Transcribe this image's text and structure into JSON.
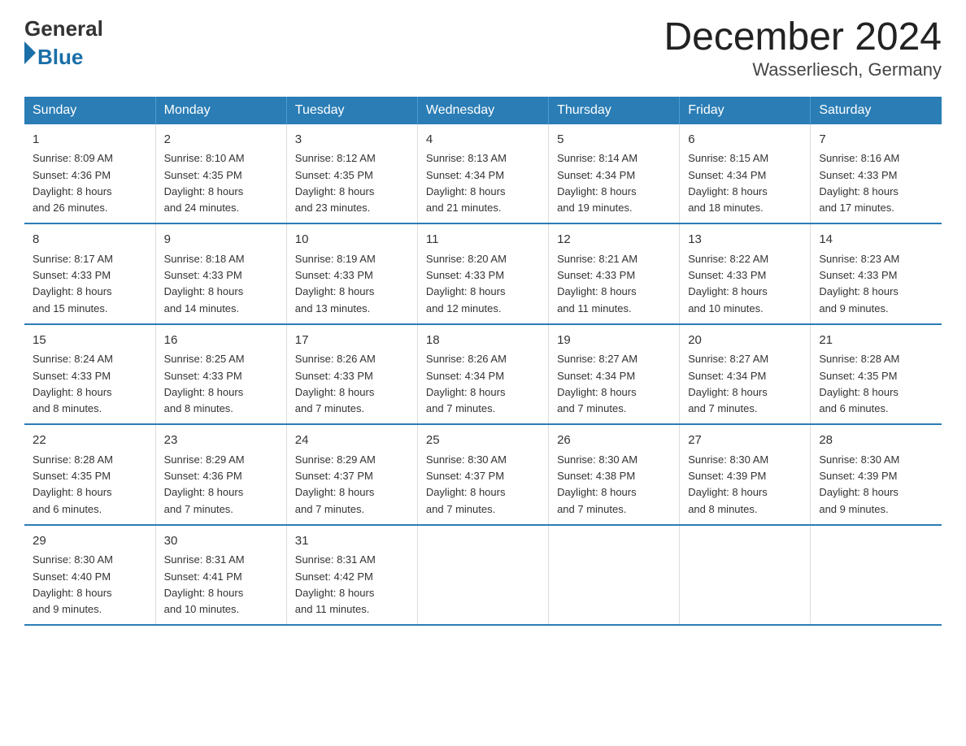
{
  "header": {
    "logo_general": "General",
    "logo_blue": "Blue",
    "title": "December 2024",
    "subtitle": "Wasserliesch, Germany"
  },
  "days_of_week": [
    "Sunday",
    "Monday",
    "Tuesday",
    "Wednesday",
    "Thursday",
    "Friday",
    "Saturday"
  ],
  "weeks": [
    [
      {
        "day": "1",
        "sunrise": "8:09 AM",
        "sunset": "4:36 PM",
        "daylight": "8 hours and 26 minutes."
      },
      {
        "day": "2",
        "sunrise": "8:10 AM",
        "sunset": "4:35 PM",
        "daylight": "8 hours and 24 minutes."
      },
      {
        "day": "3",
        "sunrise": "8:12 AM",
        "sunset": "4:35 PM",
        "daylight": "8 hours and 23 minutes."
      },
      {
        "day": "4",
        "sunrise": "8:13 AM",
        "sunset": "4:34 PM",
        "daylight": "8 hours and 21 minutes."
      },
      {
        "day": "5",
        "sunrise": "8:14 AM",
        "sunset": "4:34 PM",
        "daylight": "8 hours and 19 minutes."
      },
      {
        "day": "6",
        "sunrise": "8:15 AM",
        "sunset": "4:34 PM",
        "daylight": "8 hours and 18 minutes."
      },
      {
        "day": "7",
        "sunrise": "8:16 AM",
        "sunset": "4:33 PM",
        "daylight": "8 hours and 17 minutes."
      }
    ],
    [
      {
        "day": "8",
        "sunrise": "8:17 AM",
        "sunset": "4:33 PM",
        "daylight": "8 hours and 15 minutes."
      },
      {
        "day": "9",
        "sunrise": "8:18 AM",
        "sunset": "4:33 PM",
        "daylight": "8 hours and 14 minutes."
      },
      {
        "day": "10",
        "sunrise": "8:19 AM",
        "sunset": "4:33 PM",
        "daylight": "8 hours and 13 minutes."
      },
      {
        "day": "11",
        "sunrise": "8:20 AM",
        "sunset": "4:33 PM",
        "daylight": "8 hours and 12 minutes."
      },
      {
        "day": "12",
        "sunrise": "8:21 AM",
        "sunset": "4:33 PM",
        "daylight": "8 hours and 11 minutes."
      },
      {
        "day": "13",
        "sunrise": "8:22 AM",
        "sunset": "4:33 PM",
        "daylight": "8 hours and 10 minutes."
      },
      {
        "day": "14",
        "sunrise": "8:23 AM",
        "sunset": "4:33 PM",
        "daylight": "8 hours and 9 minutes."
      }
    ],
    [
      {
        "day": "15",
        "sunrise": "8:24 AM",
        "sunset": "4:33 PM",
        "daylight": "8 hours and 8 minutes."
      },
      {
        "day": "16",
        "sunrise": "8:25 AM",
        "sunset": "4:33 PM",
        "daylight": "8 hours and 8 minutes."
      },
      {
        "day": "17",
        "sunrise": "8:26 AM",
        "sunset": "4:33 PM",
        "daylight": "8 hours and 7 minutes."
      },
      {
        "day": "18",
        "sunrise": "8:26 AM",
        "sunset": "4:34 PM",
        "daylight": "8 hours and 7 minutes."
      },
      {
        "day": "19",
        "sunrise": "8:27 AM",
        "sunset": "4:34 PM",
        "daylight": "8 hours and 7 minutes."
      },
      {
        "day": "20",
        "sunrise": "8:27 AM",
        "sunset": "4:34 PM",
        "daylight": "8 hours and 7 minutes."
      },
      {
        "day": "21",
        "sunrise": "8:28 AM",
        "sunset": "4:35 PM",
        "daylight": "8 hours and 6 minutes."
      }
    ],
    [
      {
        "day": "22",
        "sunrise": "8:28 AM",
        "sunset": "4:35 PM",
        "daylight": "8 hours and 6 minutes."
      },
      {
        "day": "23",
        "sunrise": "8:29 AM",
        "sunset": "4:36 PM",
        "daylight": "8 hours and 7 minutes."
      },
      {
        "day": "24",
        "sunrise": "8:29 AM",
        "sunset": "4:37 PM",
        "daylight": "8 hours and 7 minutes."
      },
      {
        "day": "25",
        "sunrise": "8:30 AM",
        "sunset": "4:37 PM",
        "daylight": "8 hours and 7 minutes."
      },
      {
        "day": "26",
        "sunrise": "8:30 AM",
        "sunset": "4:38 PM",
        "daylight": "8 hours and 7 minutes."
      },
      {
        "day": "27",
        "sunrise": "8:30 AM",
        "sunset": "4:39 PM",
        "daylight": "8 hours and 8 minutes."
      },
      {
        "day": "28",
        "sunrise": "8:30 AM",
        "sunset": "4:39 PM",
        "daylight": "8 hours and 9 minutes."
      }
    ],
    [
      {
        "day": "29",
        "sunrise": "8:30 AM",
        "sunset": "4:40 PM",
        "daylight": "8 hours and 9 minutes."
      },
      {
        "day": "30",
        "sunrise": "8:31 AM",
        "sunset": "4:41 PM",
        "daylight": "8 hours and 10 minutes."
      },
      {
        "day": "31",
        "sunrise": "8:31 AM",
        "sunset": "4:42 PM",
        "daylight": "8 hours and 11 minutes."
      },
      null,
      null,
      null,
      null
    ]
  ],
  "labels": {
    "sunrise": "Sunrise:",
    "sunset": "Sunset:",
    "daylight": "Daylight:"
  }
}
